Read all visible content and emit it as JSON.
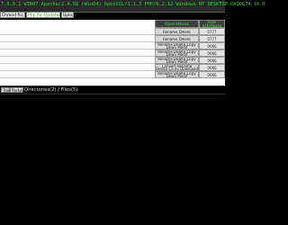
{
  "header": {
    "status_line": "7.6.0.1    WIN07    Apache/2.4.58 (Win64) OpenSSL/3.1.3 PHP/8.2.12    Windows NT DESKTOP-DAQQG74 10.0"
  },
  "controls": {
    "prefix_button": "Chmod fiic",
    "path_value": "Php fiic-Updated",
    "go_button": "Upload"
  },
  "table": {
    "operations_header": "Operations",
    "attribute_header": "File attribute",
    "rows": [
      {
        "operation": "Rename Delete Package",
        "attr": "0777"
      },
      {
        "operation": "Rename Delete Package",
        "attr": "0777"
      },
      {
        "operation": "Rename Delete Copy Down Modif",
        "attr": "0666"
      },
      {
        "operation": "Rename Delete Copy Down Modif",
        "attr": "0666"
      },
      {
        "operation": "Rename Delete Copy Down Modif",
        "attr": "0666"
      },
      {
        "operation": "Convert Rename Delete Co py Download",
        "attr": "0666"
      },
      {
        "operation": "Rename Delete Copy Down Modif",
        "attr": "0666"
      }
    ]
  },
  "bottom": {
    "tab_a": "Trail",
    "tab_b": "Package",
    "dir_info": "Directories(2) / Files(5)"
  },
  "colors": {
    "background": "#000000",
    "accent_green": "#2ad62a",
    "header_bg": "#3d3d3d"
  }
}
